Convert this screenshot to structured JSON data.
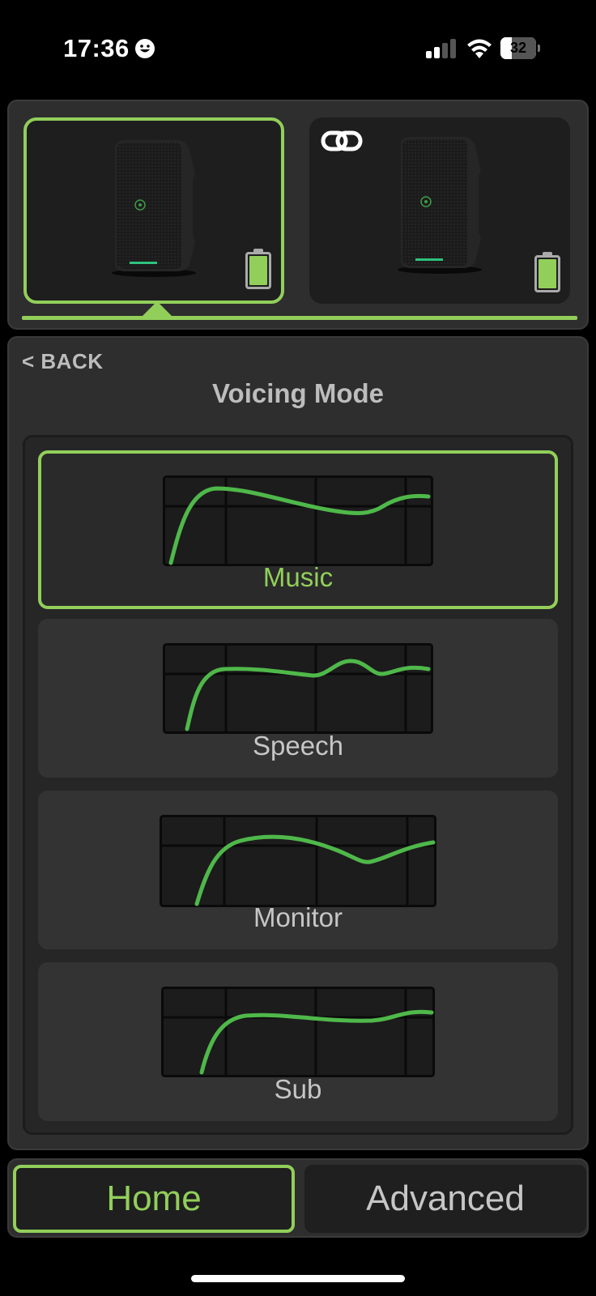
{
  "status_bar": {
    "time": "17:36",
    "battery_percent": "32",
    "battery_level": 0.32,
    "signal_bars": 2,
    "icons": [
      "emoji-icon",
      "signal-icon",
      "wifi-icon",
      "battery-icon"
    ]
  },
  "speakers": [
    {
      "selected": true,
      "battery_level": 1.0,
      "linked": false
    },
    {
      "selected": false,
      "battery_level": 1.0,
      "linked": true
    }
  ],
  "header": {
    "back_label": "< BACK",
    "title": "Voicing Mode"
  },
  "modes": [
    {
      "label": "Music",
      "active": true
    },
    {
      "label": "Speech",
      "active": false
    },
    {
      "label": "Monitor",
      "active": false
    },
    {
      "label": "Sub",
      "active": false
    }
  ],
  "tabs": {
    "home": "Home",
    "advanced": "Advanced",
    "active": "home"
  },
  "colors": {
    "accent": "#92cf5a",
    "curve": "#4fb84a",
    "panel": "#2e2e2e",
    "background": "#000000"
  }
}
